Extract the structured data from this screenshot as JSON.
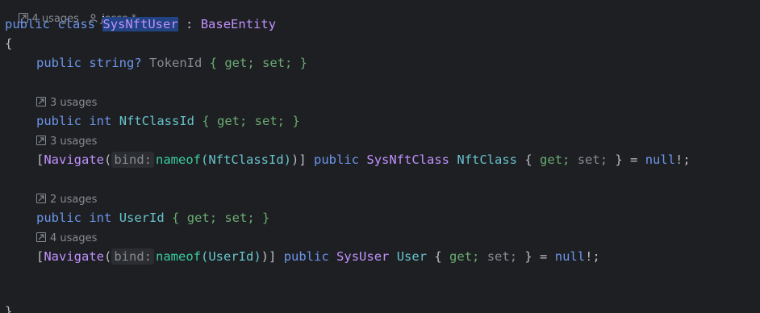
{
  "header_hint": {
    "usages": "4 usages",
    "author": "jesse *"
  },
  "line1": {
    "public": "public",
    "class": "class",
    "name": "SysNftUser",
    "colon": ":",
    "base": "BaseEntity"
  },
  "line2": {
    "brace": "{"
  },
  "line3": {
    "public": "public",
    "type": "string?",
    "name": "TokenId",
    "body": "{ get; set; }"
  },
  "hint2": "3 usages",
  "line5": {
    "public": "public",
    "type": "int",
    "name": "NftClassId",
    "body": "{ get; set; }"
  },
  "hint3": "3 usages",
  "line6": {
    "open": "[",
    "attr": "Navigate",
    "paren_open": "(",
    "param_hint": "bind:",
    "fn": "nameof",
    "arg": "(NftClassId)",
    "close": ")]",
    "public": "public",
    "type": "SysNftClass",
    "name": "NftClass",
    "get": "get;",
    "set": "set;",
    "tail": "} =",
    "null": "null",
    "end": "!;"
  },
  "hint4": "2 usages",
  "line8": {
    "public": "public",
    "type": "int",
    "name": "UserId",
    "body": "{ get; set; }"
  },
  "hint5": "4 usages",
  "line9": {
    "open": "[",
    "attr": "Navigate",
    "paren_open": "(",
    "param_hint": "bind:",
    "fn": "nameof",
    "arg": "(UserId)",
    "close": ")]",
    "public": "public",
    "type": "SysUser",
    "name": "User",
    "get": "get;",
    "set": "set;",
    "tail": "} =",
    "null": "null",
    "end": "!;"
  },
  "line_last": {
    "brace": "}"
  }
}
